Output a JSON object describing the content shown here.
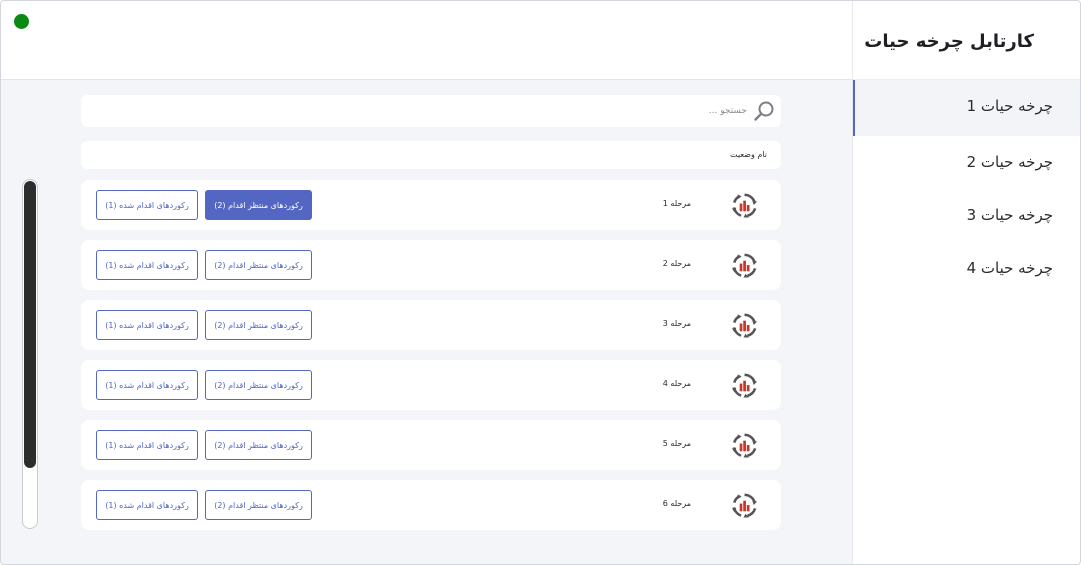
{
  "header": {
    "status": "online"
  },
  "sidebar": {
    "title": "کارتابل چرخه حیات",
    "items": [
      {
        "label": "چرخه حیات 1",
        "active": true
      },
      {
        "label": "چرخه حیات 2",
        "active": false
      },
      {
        "label": "چرخه حیات 3",
        "active": false
      },
      {
        "label": "چرخه حیات 4",
        "active": false
      }
    ]
  },
  "search": {
    "placeholder": "جستجو ..."
  },
  "table": {
    "column_name": "نام وضعیت",
    "rows": [
      {
        "stage": "مرحله 1",
        "pending_label": "رکوردهای منتظر اقدام (2)",
        "done_label": "رکوردهای اقدام شده (1)",
        "pending_selected": true
      },
      {
        "stage": "مرحله 2",
        "pending_label": "رکوردهای منتظر اقدام (2)",
        "done_label": "رکوردهای اقدام شده (1)",
        "pending_selected": false
      },
      {
        "stage": "مرحله 3",
        "pending_label": "رکوردهای منتظر اقدام (2)",
        "done_label": "رکوردهای اقدام شده (1)",
        "pending_selected": false
      },
      {
        "stage": "مرحله 4",
        "pending_label": "رکوردهای منتظر اقدام (2)",
        "done_label": "رکوردهای اقدام شده (1)",
        "pending_selected": false
      },
      {
        "stage": "مرحله 5",
        "pending_label": "رکوردهای منتظر اقدام (2)",
        "done_label": "رکوردهای اقدام شده (1)",
        "pending_selected": false
      },
      {
        "stage": "مرحله 6",
        "pending_label": "رکوردهای منتظر اقدام (2)",
        "done_label": "رکوردهای اقدام شده (1)",
        "pending_selected": false
      }
    ]
  },
  "icons": {
    "stage": "lifecycle-chart-icon",
    "search": "search-icon",
    "status": "status-dot"
  },
  "colors": {
    "accent": "#5366c2",
    "status_dot": "#0a8a12",
    "icon_bars": "#c0392b"
  }
}
